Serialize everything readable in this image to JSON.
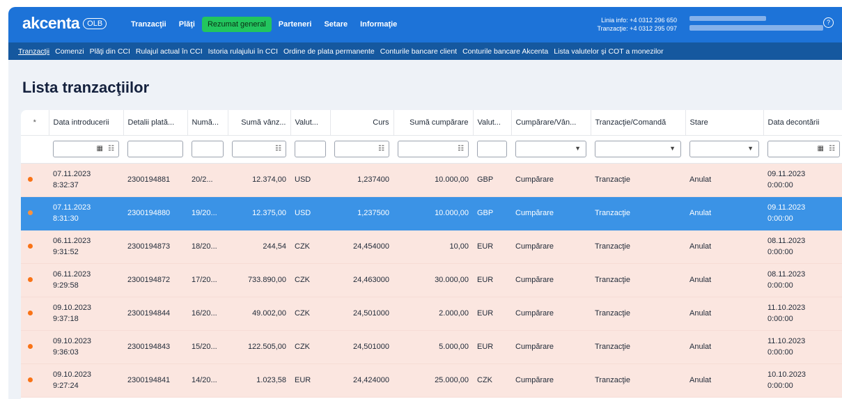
{
  "brand": {
    "name": "akcenta",
    "badge": "OLB"
  },
  "main_nav": [
    {
      "label": "Tranzacţii",
      "active": false
    },
    {
      "label": "Plăţi",
      "active": false
    },
    {
      "label": "Rezumat general",
      "active": true
    },
    {
      "label": "Parteneri",
      "active": false
    },
    {
      "label": "Setare",
      "active": false
    },
    {
      "label": "Informaţie",
      "active": false
    }
  ],
  "contact": {
    "line1": "Linia info: +4 0312 296 650",
    "line2": "Tranzacţie: +4 0312 295 097"
  },
  "sub_nav": [
    {
      "label": "Tranzacţii",
      "active": true
    },
    {
      "label": "Comenzi"
    },
    {
      "label": "Plăţi din CCI"
    },
    {
      "label": "Rulajul actual în CCI"
    },
    {
      "label": "Istoria rulajului în CCI"
    },
    {
      "label": "Ordine de plata permanente"
    },
    {
      "label": "Conturile bancare client"
    },
    {
      "label": "Conturile bancare Akcenta"
    },
    {
      "label": "Lista valutelor şi COT a monezilor"
    }
  ],
  "page_title": "Lista tranzacţiilor",
  "columns": [
    "*",
    "Data introducerii",
    "Detalii plată...",
    "Numă...",
    "Sumă vânz...",
    "Valut...",
    "Curs",
    "Sumă cumpărare",
    "Valut...",
    "Cumpărare/Vân...",
    "Tranzacţie/Comandă",
    "Stare",
    "Data decontării"
  ],
  "rows": [
    {
      "date": "07.11.2023",
      "time": "8:32:37",
      "details": "2300194881",
      "number": "20/2...",
      "sell_amount": "12.374,00",
      "sell_cur": "USD",
      "rate": "1,237400",
      "buy_amount": "10.000,00",
      "buy_cur": "GBP",
      "direction": "Cumpărare",
      "type": "Tranzacţie",
      "status": "Anulat",
      "settle_date": "09.11.2023",
      "settle_time": "0:00:00",
      "selected": false
    },
    {
      "date": "07.11.2023",
      "time": "8:31:30",
      "details": "2300194880",
      "number": "19/20...",
      "sell_amount": "12.375,00",
      "sell_cur": "USD",
      "rate": "1,237500",
      "buy_amount": "10.000,00",
      "buy_cur": "GBP",
      "direction": "Cumpărare",
      "type": "Tranzacţie",
      "status": "Anulat",
      "settle_date": "09.11.2023",
      "settle_time": "0:00:00",
      "selected": true
    },
    {
      "date": "06.11.2023",
      "time": "9:31:52",
      "details": "2300194873",
      "number": "18/20...",
      "sell_amount": "244,54",
      "sell_cur": "CZK",
      "rate": "24,454000",
      "buy_amount": "10,00",
      "buy_cur": "EUR",
      "direction": "Cumpărare",
      "type": "Tranzacţie",
      "status": "Anulat",
      "settle_date": "08.11.2023",
      "settle_time": "0:00:00",
      "selected": false
    },
    {
      "date": "06.11.2023",
      "time": "9:29:58",
      "details": "2300194872",
      "number": "17/20...",
      "sell_amount": "733.890,00",
      "sell_cur": "CZK",
      "rate": "24,463000",
      "buy_amount": "30.000,00",
      "buy_cur": "EUR",
      "direction": "Cumpărare",
      "type": "Tranzacţie",
      "status": "Anulat",
      "settle_date": "08.11.2023",
      "settle_time": "0:00:00",
      "selected": false
    },
    {
      "date": "09.10.2023",
      "time": "9:37:18",
      "details": "2300194844",
      "number": "16/20...",
      "sell_amount": "49.002,00",
      "sell_cur": "CZK",
      "rate": "24,501000",
      "buy_amount": "2.000,00",
      "buy_cur": "EUR",
      "direction": "Cumpărare",
      "type": "Tranzacţie",
      "status": "Anulat",
      "settle_date": "11.10.2023",
      "settle_time": "0:00:00",
      "selected": false
    },
    {
      "date": "09.10.2023",
      "time": "9:36:03",
      "details": "2300194843",
      "number": "15/20...",
      "sell_amount": "122.505,00",
      "sell_cur": "CZK",
      "rate": "24,501000",
      "buy_amount": "5.000,00",
      "buy_cur": "EUR",
      "direction": "Cumpărare",
      "type": "Tranzacţie",
      "status": "Anulat",
      "settle_date": "11.10.2023",
      "settle_time": "0:00:00",
      "selected": false
    },
    {
      "date": "09.10.2023",
      "time": "9:27:24",
      "details": "2300194841",
      "number": "14/20...",
      "sell_amount": "1.023,58",
      "sell_cur": "EUR",
      "rate": "24,424000",
      "buy_amount": "25.000,00",
      "buy_cur": "CZK",
      "direction": "Cumpărare",
      "type": "Tranzacţie",
      "status": "Anulat",
      "settle_date": "10.10.2023",
      "settle_time": "0:00:00",
      "selected": false
    }
  ],
  "colors": {
    "header": "#1d73d8",
    "subnav": "#15589f",
    "active_tab": "#22c55e",
    "row": "#fbe6e0",
    "selected_row": "#3b93e6",
    "status_dot": "#f97316"
  }
}
